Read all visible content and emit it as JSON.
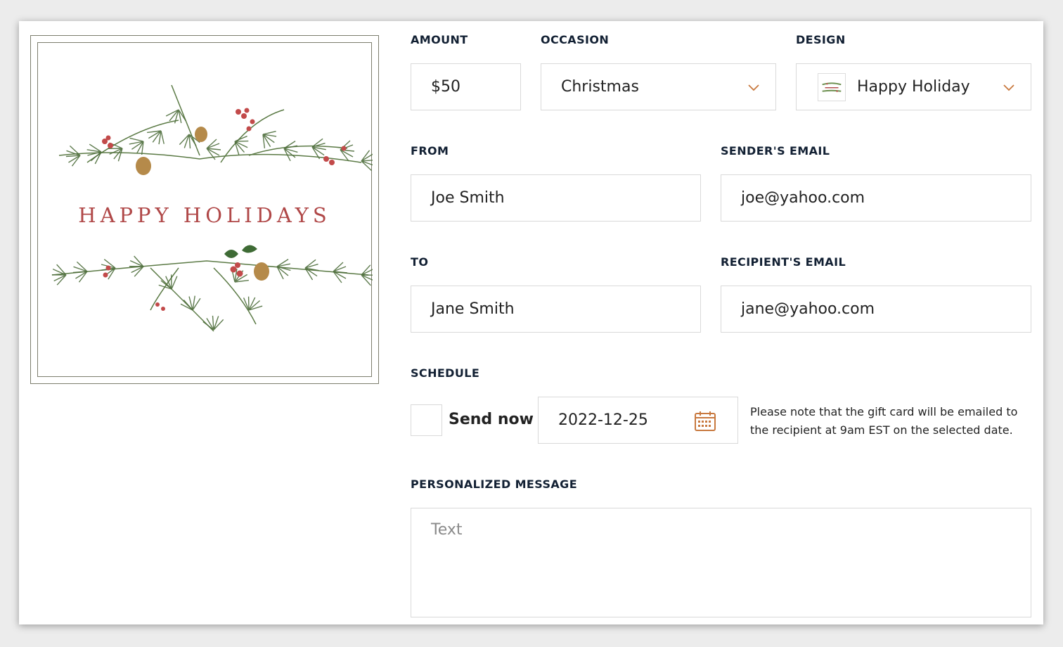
{
  "card": {
    "title": "HAPPY HOLIDAYS"
  },
  "form": {
    "amount": {
      "label": "AMOUNT",
      "value": "$50"
    },
    "occasion": {
      "label": "OCCASION",
      "value": "Christmas"
    },
    "design": {
      "label": "DESIGN",
      "value": "Happy Holiday"
    },
    "from": {
      "label": "FROM",
      "value": "Joe Smith"
    },
    "sender_email": {
      "label": "SENDER'S EMAIL",
      "value": "joe@yahoo.com"
    },
    "to": {
      "label": "TO",
      "value": "Jane Smith"
    },
    "recipient_email": {
      "label": "RECIPIENT'S EMAIL",
      "value": "jane@yahoo.com"
    },
    "schedule": {
      "label": "SCHEDULE",
      "send_now_label": "Send now",
      "send_now_checked": false,
      "date": "2022-12-25",
      "note": "Please note that the gift card will be emailed to the recipient at 9am EST on the selected date."
    },
    "message": {
      "label": "PERSONALIZED MESSAGE",
      "placeholder": "Text",
      "value": ""
    }
  },
  "colors": {
    "label": "#122033",
    "card_title": "#b04848",
    "accent_icon": "#c8793f",
    "border": "#d9d9d9"
  },
  "icons": {
    "dropdown": "chevron-down-icon",
    "date": "calendar-icon"
  }
}
